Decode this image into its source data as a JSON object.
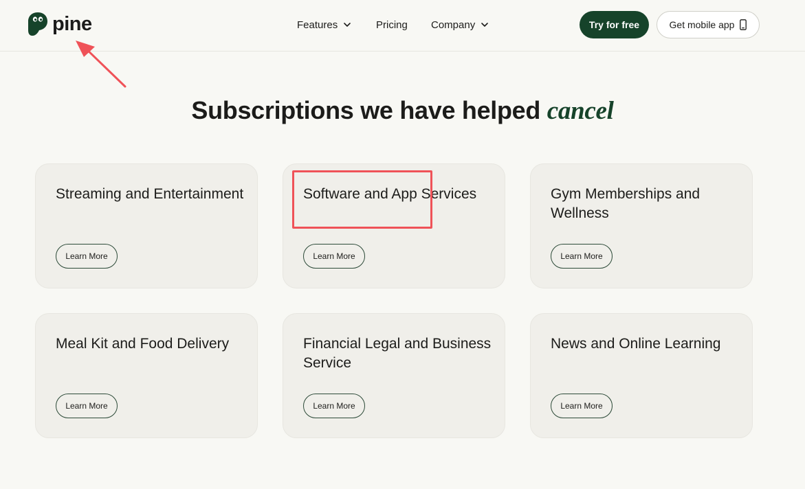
{
  "header": {
    "logo_text": "pine",
    "nav": {
      "features": "Features",
      "pricing": "Pricing",
      "company": "Company"
    },
    "try_button": "Try for free",
    "mobile_button": "Get mobile app"
  },
  "main": {
    "heading": "Subscriptions we have helped",
    "heading_accent": "cancel",
    "cards": [
      {
        "title": "Streaming and Entertainment",
        "button": "Learn More"
      },
      {
        "title": "Software and App Services",
        "button": "Learn More"
      },
      {
        "title": "Gym Memberships and Wellness",
        "button": "Learn More"
      },
      {
        "title": "Meal Kit and Food Delivery",
        "button": "Learn More"
      },
      {
        "title": "Financial Legal and Business Service",
        "button": "Learn More"
      },
      {
        "title": "News and Online Learning",
        "button": "Learn More"
      }
    ]
  },
  "colors": {
    "brand_green": "#16432a",
    "background": "#f8f8f4",
    "card_background": "#f0efea",
    "annotation_red": "#ef5258"
  },
  "icons": [
    "pine-logo-icon",
    "chevron-down-icon",
    "phone-icon",
    "annotation-arrow-icon"
  ]
}
